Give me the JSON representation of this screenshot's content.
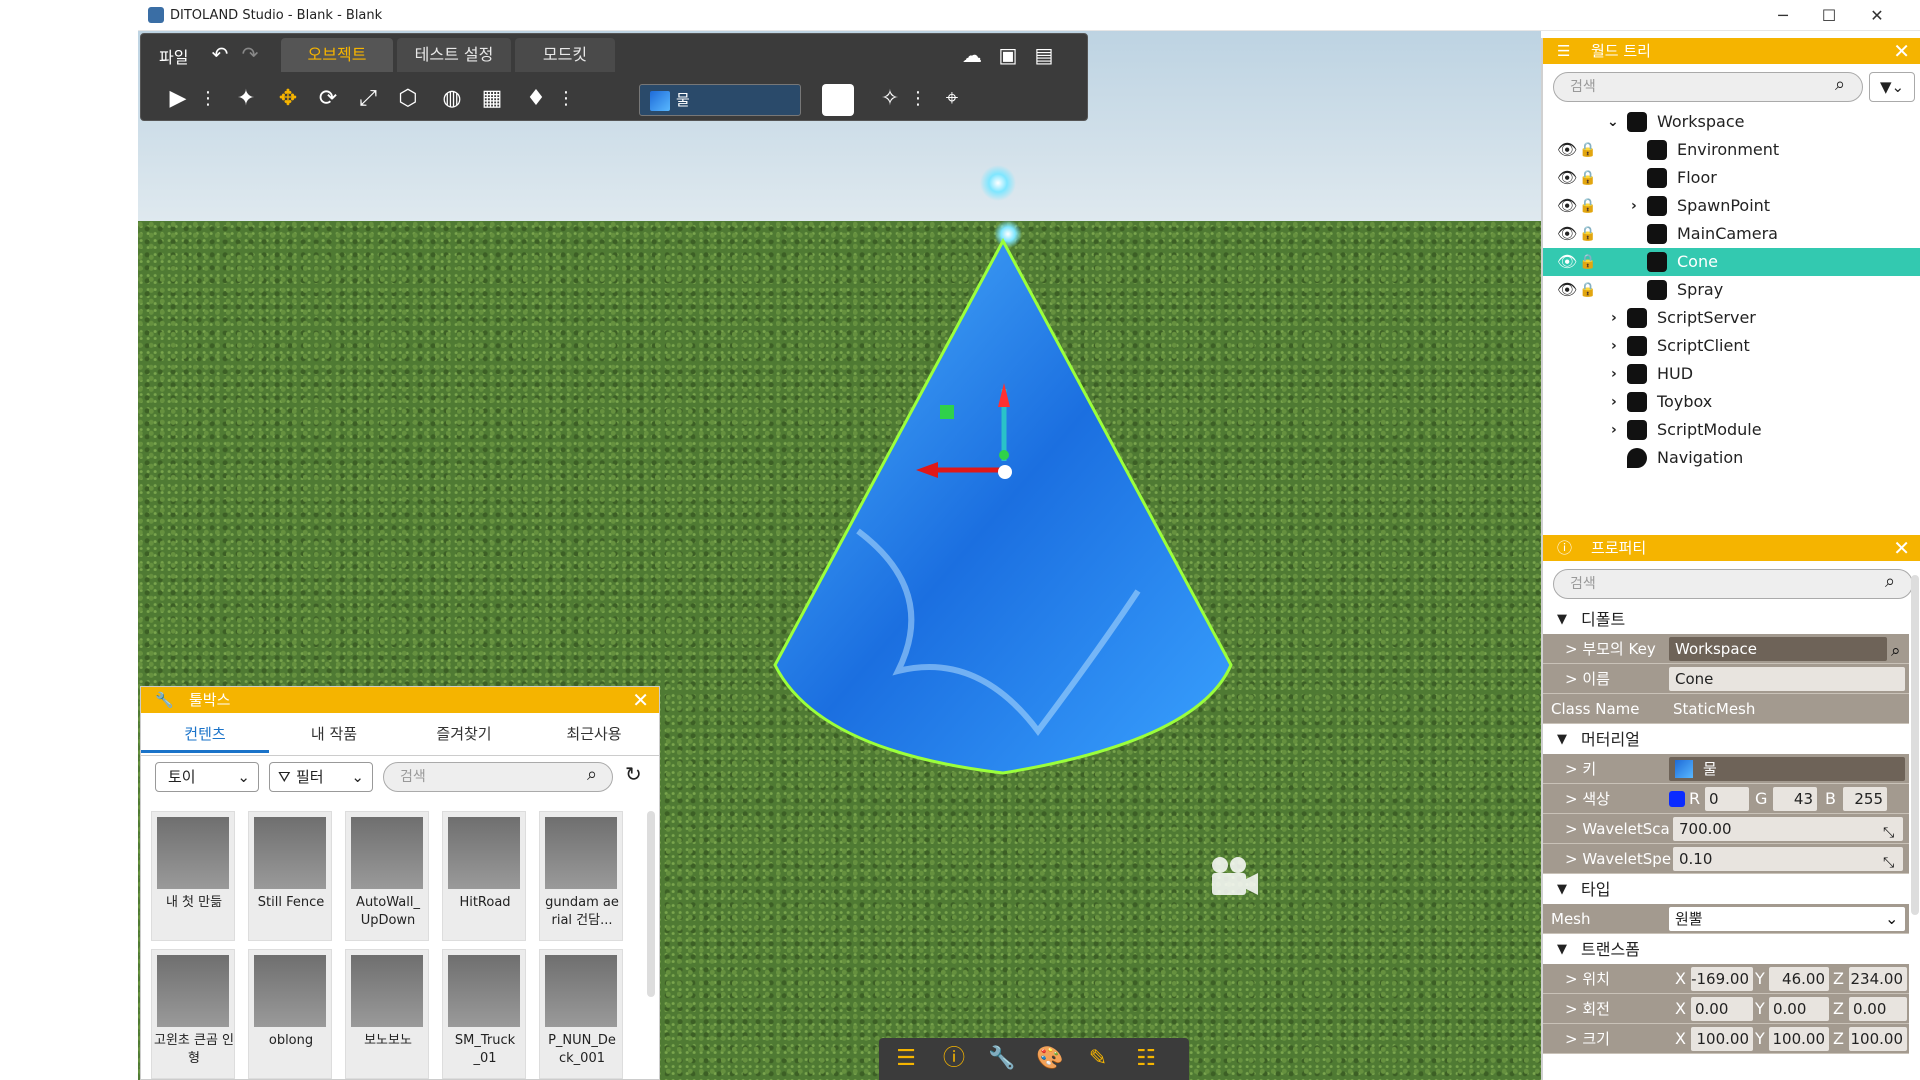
{
  "window": {
    "title": "DITOLAND Studio - Blank - Blank",
    "minimize": "─",
    "maximize": "☐",
    "close": "✕"
  },
  "toolbar": {
    "file_label": "파일",
    "tabs": [
      "오브젝트",
      "테스트 설정",
      "모드킷"
    ],
    "material_label": "물",
    "colors": {
      "bg": "#3b3b3b",
      "accent": "#f6b400"
    }
  },
  "world_tree": {
    "title": "월드 트리",
    "search_placeholder": "검색",
    "items": [
      {
        "label": "Workspace",
        "icon": "workspace-icon"
      },
      {
        "label": "Environment",
        "icon": "environment-icon"
      },
      {
        "label": "Floor",
        "icon": "cube-icon"
      },
      {
        "label": "SpawnPoint",
        "icon": "cube-icon"
      },
      {
        "label": "MainCamera",
        "icon": "camera-icon"
      },
      {
        "label": "Cone",
        "icon": "cube-icon"
      },
      {
        "label": "Spray",
        "icon": "spray-icon"
      },
      {
        "label": "ScriptServer",
        "icon": "script-server-icon"
      },
      {
        "label": "ScriptClient",
        "icon": "script-client-icon"
      },
      {
        "label": "HUD",
        "icon": "hud-icon"
      },
      {
        "label": "Toybox",
        "icon": "toybox-icon"
      },
      {
        "label": "ScriptModule",
        "icon": "script-module-icon"
      },
      {
        "label": "Navigation",
        "icon": "navigation-icon"
      }
    ],
    "selected": "Cone"
  },
  "properties": {
    "title": "프로퍼티",
    "search_placeholder": "검색",
    "sections": {
      "default": "디폴트",
      "material": "머터리얼",
      "type": "타입",
      "transform": "트랜스폼"
    },
    "rows": {
      "parent_key": {
        "label": "> 부모의 Key",
        "value": "Workspace"
      },
      "name": {
        "label": "> 이름",
        "value": "Cone"
      },
      "class_name": {
        "label": "Class Name",
        "value": "StaticMesh"
      },
      "key": {
        "label": "> 키",
        "value": "물"
      },
      "color": {
        "label": "> 색상",
        "r": "0",
        "g": "43",
        "b": "255",
        "swatch": "#0a2bff"
      },
      "wavelet_scale": {
        "label": "> WaveletSca",
        "value": "700.00"
      },
      "wavelet_speed": {
        "label": "> WaveletSpe",
        "value": "0.10"
      },
      "mesh": {
        "label": "Mesh",
        "value": "원뿔"
      },
      "position": {
        "label": "> 위치",
        "x": "-169.00",
        "y": "46.00",
        "z": "234.00"
      },
      "rotation": {
        "label": "> 회전",
        "x": "0.00",
        "y": "0.00",
        "z": "0.00"
      },
      "scale": {
        "label": "> 크기",
        "x": "100.00",
        "y": "100.00",
        "z": "100.00"
      }
    },
    "axis": {
      "x": "X",
      "y": "Y",
      "z": "Z",
      "r": "R",
      "g": "G",
      "b": "B"
    }
  },
  "toybox": {
    "title": "툴박스",
    "tabs": [
      "컨텐츠",
      "내 작품",
      "즐겨찾기",
      "최근사용"
    ],
    "category_select": "토이",
    "filter_label": "필터",
    "search_placeholder": "검색",
    "items": [
      {
        "label": "내 첫 만듦"
      },
      {
        "label": "Still Fence"
      },
      {
        "label": "AutoWall_ UpDown"
      },
      {
        "label": "HitRoad"
      },
      {
        "label": "gundam ae rial 건담..."
      },
      {
        "label": "고윈초 큰곰 인형"
      },
      {
        "label": "oblong"
      },
      {
        "label": "보노보노"
      },
      {
        "label": "SM_Truck _01"
      },
      {
        "label": "P_NUN_De ck_001"
      }
    ]
  }
}
